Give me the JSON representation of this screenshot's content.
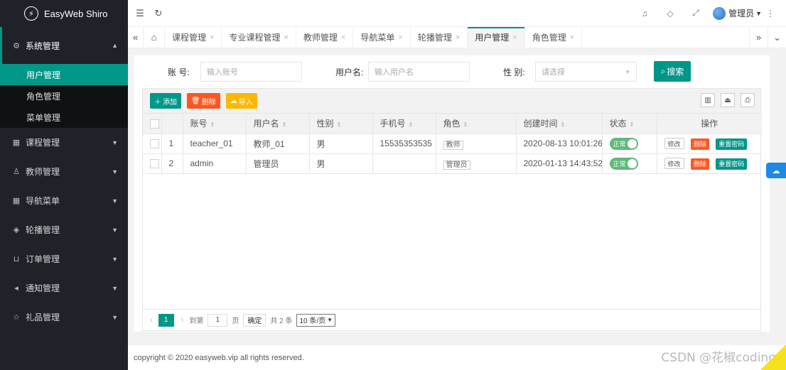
{
  "app": {
    "title": "EasyWeb Shiro"
  },
  "sidebar": {
    "groups": [
      {
        "label": "系统管理",
        "icon": "gear-icon",
        "open": true,
        "items": [
          {
            "label": "用户管理",
            "active": true
          },
          {
            "label": "角色管理"
          },
          {
            "label": "菜单管理"
          }
        ]
      },
      {
        "label": "课程管理",
        "icon": "grid-icon"
      },
      {
        "label": "教师管理",
        "icon": "user-icon"
      },
      {
        "label": "导航菜单",
        "icon": "grid-icon"
      },
      {
        "label": "轮播管理",
        "icon": "cube-icon"
      },
      {
        "label": "订单管理",
        "icon": "cart-icon"
      },
      {
        "label": "通知管理",
        "icon": "speaker-icon"
      },
      {
        "label": "礼品管理",
        "icon": "star-icon"
      }
    ]
  },
  "header": {
    "user": "管理员"
  },
  "tabs": [
    {
      "label": "课程管理"
    },
    {
      "label": "专业课程管理"
    },
    {
      "label": "教师管理"
    },
    {
      "label": "导航菜单"
    },
    {
      "label": "轮播管理"
    },
    {
      "label": "用户管理",
      "active": true
    },
    {
      "label": "角色管理"
    }
  ],
  "search": {
    "account_label": "账  号:",
    "account_placeholder": "输入账号",
    "username_label": "用户名:",
    "username_placeholder": "输入用户名",
    "gender_label": "性  别:",
    "gender_placeholder": "请选择",
    "search_button": "搜索"
  },
  "toolbar": {
    "add": "添加",
    "delete": "删除",
    "import": "导入"
  },
  "table": {
    "columns": [
      "账号",
      "用户名",
      "性别",
      "手机号",
      "角色",
      "创建时间",
      "状态",
      "操作"
    ],
    "rows": [
      {
        "index": "1",
        "account": "teacher_01",
        "username": "教师_01",
        "gender": "男",
        "phone": "15535353535",
        "role": "教师",
        "created": "2020-08-13 10:01:26",
        "status": "正常"
      },
      {
        "index": "2",
        "account": "admin",
        "username": "管理员",
        "gender": "男",
        "phone": "",
        "role": "管理员",
        "created": "2020-01-13 14:43:52",
        "status": "正常"
      }
    ],
    "actions": {
      "edit": "修改",
      "delete": "删除",
      "reset": "重置密码"
    }
  },
  "pager": {
    "current": "1",
    "goto_label": "到第",
    "page_value": "1",
    "page_unit": "页",
    "confirm": "确定",
    "total": "共 2 条",
    "limit": "10 条/页"
  },
  "footer": {
    "copyright": "copyright © 2020 easyweb.vip all rights reserved."
  },
  "watermark": "CSDN @花椒coding",
  "colors": {
    "primary": "#009688",
    "danger": "#ff5722",
    "warning": "#ffb800",
    "sidebar": "#20222a"
  }
}
